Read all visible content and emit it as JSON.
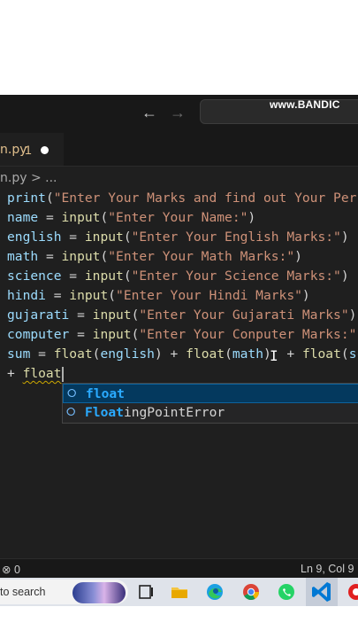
{
  "watermark": "www.BANDIC",
  "tab": {
    "name": "n.py",
    "problems": "1"
  },
  "breadcrumb": "n.py > ...",
  "code_lines": [
    [
      [
        "v",
        "print"
      ],
      [
        "o",
        "("
      ],
      [
        "s",
        "\"Enter Your Marks and find out Your Per"
      ]
    ],
    [
      [
        "v",
        "name"
      ],
      [
        "o",
        " = "
      ],
      [
        "f",
        "input"
      ],
      [
        "o",
        "("
      ],
      [
        "s",
        "\"Enter Your Name:\""
      ],
      [
        "o",
        ")"
      ]
    ],
    [
      [
        "v",
        "english"
      ],
      [
        "o",
        " = "
      ],
      [
        "f",
        "input"
      ],
      [
        "o",
        "("
      ],
      [
        "s",
        "\"Enter Your English Marks:\""
      ],
      [
        "o",
        ")"
      ]
    ],
    [
      [
        "v",
        "math"
      ],
      [
        "o",
        " = "
      ],
      [
        "f",
        "input"
      ],
      [
        "o",
        "("
      ],
      [
        "s",
        "\"Enter Your Math Marks:\""
      ],
      [
        "o",
        ")"
      ]
    ],
    [
      [
        "v",
        "science"
      ],
      [
        "o",
        " = "
      ],
      [
        "f",
        "input"
      ],
      [
        "o",
        "("
      ],
      [
        "s",
        "\"Enter Your Science Marks:\""
      ],
      [
        "o",
        ")"
      ]
    ],
    [
      [
        "v",
        "hindi"
      ],
      [
        "o",
        " = "
      ],
      [
        "f",
        "input"
      ],
      [
        "o",
        "("
      ],
      [
        "s",
        "\"Enter Your Hindi Marks\""
      ],
      [
        "o",
        ")"
      ]
    ],
    [
      [
        "v",
        "gujarati"
      ],
      [
        "o",
        " = "
      ],
      [
        "f",
        "input"
      ],
      [
        "o",
        "("
      ],
      [
        "s",
        "\"Enter Your Gujarati Marks\""
      ],
      [
        "o",
        ")"
      ]
    ],
    [
      [
        "v",
        "computer"
      ],
      [
        "o",
        " = "
      ],
      [
        "f",
        "input"
      ],
      [
        "o",
        "("
      ],
      [
        "s",
        "\"Enter Your Conputer Marks:\""
      ]
    ],
    [
      [
        "v",
        "sum"
      ],
      [
        "o",
        " = "
      ],
      [
        "f",
        "float"
      ],
      [
        "o",
        "("
      ],
      [
        "v",
        "english"
      ],
      [
        "o",
        ") + "
      ],
      [
        "f",
        "float"
      ],
      [
        "o",
        "("
      ],
      [
        "v",
        "math"
      ],
      [
        "o",
        ")  + "
      ],
      [
        "f",
        "float"
      ],
      [
        "o",
        "("
      ],
      [
        "v",
        "sc"
      ]
    ],
    [
      [
        "o",
        "+ "
      ],
      [
        "f",
        "float"
      ]
    ]
  ],
  "suggestions": [
    {
      "match": "float",
      "rest": ""
    },
    {
      "match": "Float",
      "rest": "ingPointError"
    }
  ],
  "status": {
    "problems": "0",
    "position": "Ln 9, Col 9"
  },
  "taskbar": {
    "search_placeholder": "to search"
  }
}
